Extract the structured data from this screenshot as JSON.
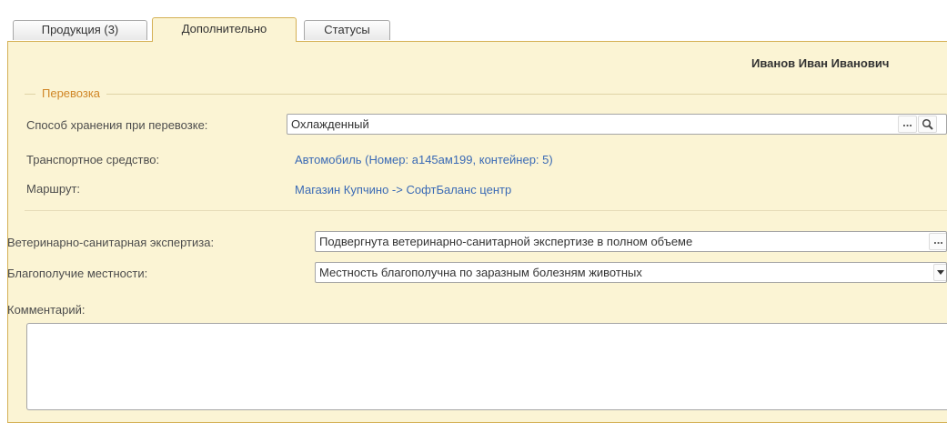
{
  "tabs": [
    {
      "label": "Продукция (3)"
    },
    {
      "label": "Дополнительно"
    },
    {
      "label": "Статусы"
    }
  ],
  "user_name": "Иванов Иван Иванович",
  "transport_group": {
    "title": "Перевозка",
    "storage_label": "Способ хранения при перевозке:",
    "storage_value": "Охлажденный",
    "vehicle_label": "Транспортное средство:",
    "vehicle_value": "Автомобиль (Номер: а145ам199, контейнер: 5)",
    "route_label": "Маршрут:",
    "route_value": "Магазин Купчино -> СофтБаланс центр"
  },
  "vet_label": "Ветеринарно-санитарная экспертиза:",
  "vet_value": "Подвергнута ветеринарно-санитарной экспертизе в полном объеме",
  "locality_label": "Благополучие местности:",
  "locality_value": "Местность благополучна по заразным болезням животных",
  "comment_label": "Комментарий:",
  "comment_value": "",
  "icons": {
    "ellipsis": "...",
    "search": "search-icon",
    "dropdown": "chevron-down-icon"
  },
  "colors": {
    "panel_bg": "#fbf4d4",
    "active_tab_border": "#d4b054",
    "group_title": "#d08626",
    "link": "#3a6ab5"
  }
}
